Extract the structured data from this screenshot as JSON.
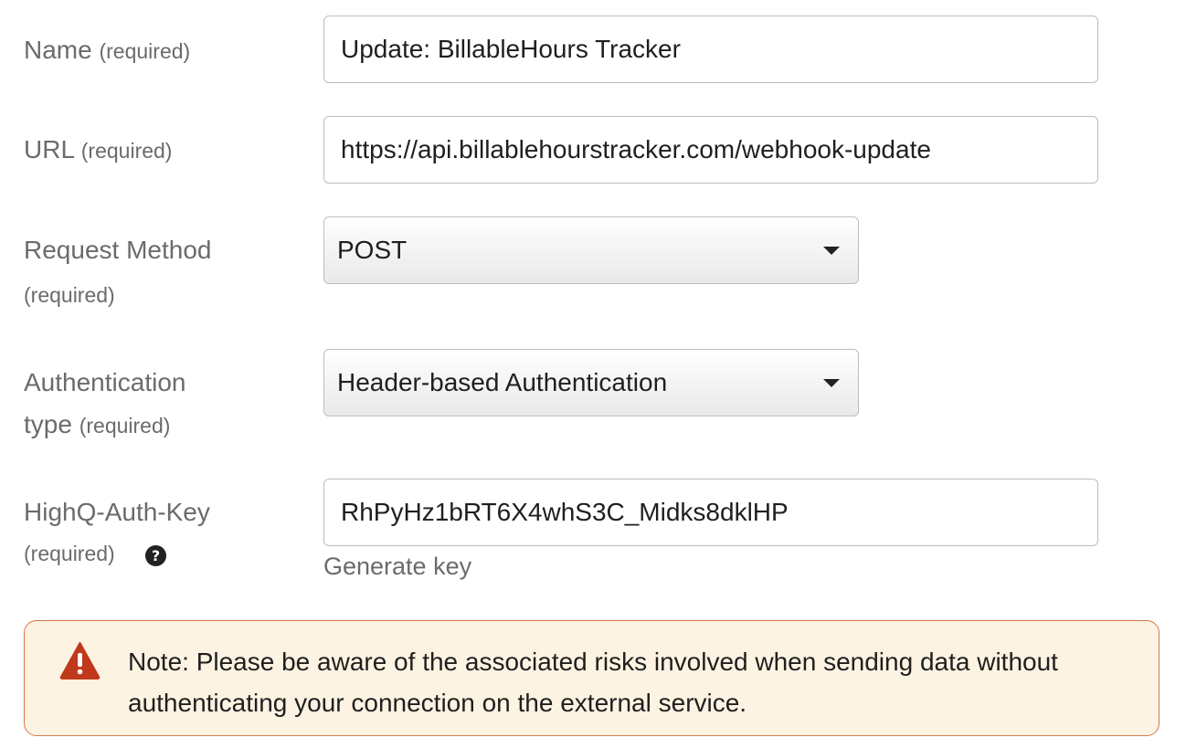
{
  "fields": {
    "name": {
      "label": "Name",
      "required": "(required)",
      "value": "Update: BillableHours Tracker"
    },
    "url": {
      "label": "URL",
      "required": "(required)",
      "value": "https://api.billablehourstracker.com/webhook-update"
    },
    "request_method": {
      "label": "Request Method",
      "required": "(required)",
      "value": "POST"
    },
    "auth_type": {
      "label_line1": "Authentication",
      "label_line2": "type",
      "required": "(required)",
      "value": "Header-based Authentication"
    },
    "auth_key": {
      "label": "HighQ-Auth-Key",
      "required": "(required)",
      "value": "RhPyHz1bRT6X4whS3C_Midks8dklHP",
      "help_icon": "question-circle-icon",
      "generate_label": "Generate key"
    }
  },
  "warning": {
    "icon": "warning-triangle-icon",
    "text": "Note: Please be aware of the associated risks involved when sending data without authenticating your connection on the external service."
  },
  "colors": {
    "label": "#6b6b6b",
    "warning_border": "#d9774a",
    "warning_bg": "#fdf3e2",
    "warning_icon": "#c0391b"
  }
}
